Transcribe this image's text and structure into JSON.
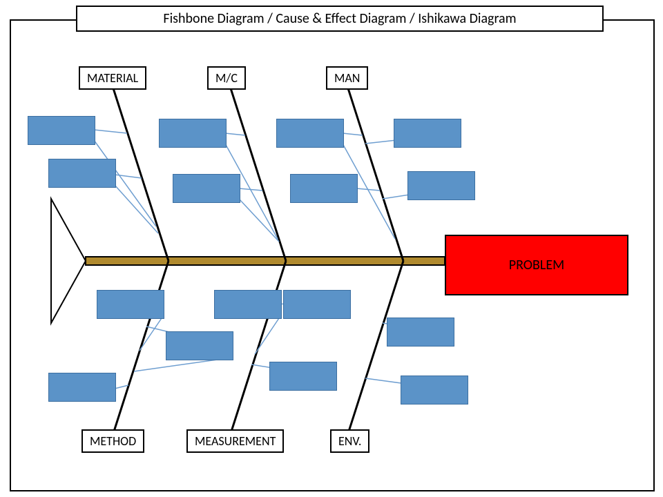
{
  "title": "Fishbone Diagram / Cause & Effect Diagram / Ishikawa Diagram",
  "problem": "PROBLEM",
  "categories": {
    "top": [
      "MATERIAL",
      "M/C",
      "MAN"
    ],
    "bottom": [
      "METHOD",
      "MEASUREMENT",
      "ENV."
    ]
  },
  "colors": {
    "spine": "#b08a2e",
    "cause_fill": "#5b93c8",
    "cause_border": "#3b6ea0",
    "problem_fill": "#ff0000",
    "connector": "#6e9ed0"
  }
}
